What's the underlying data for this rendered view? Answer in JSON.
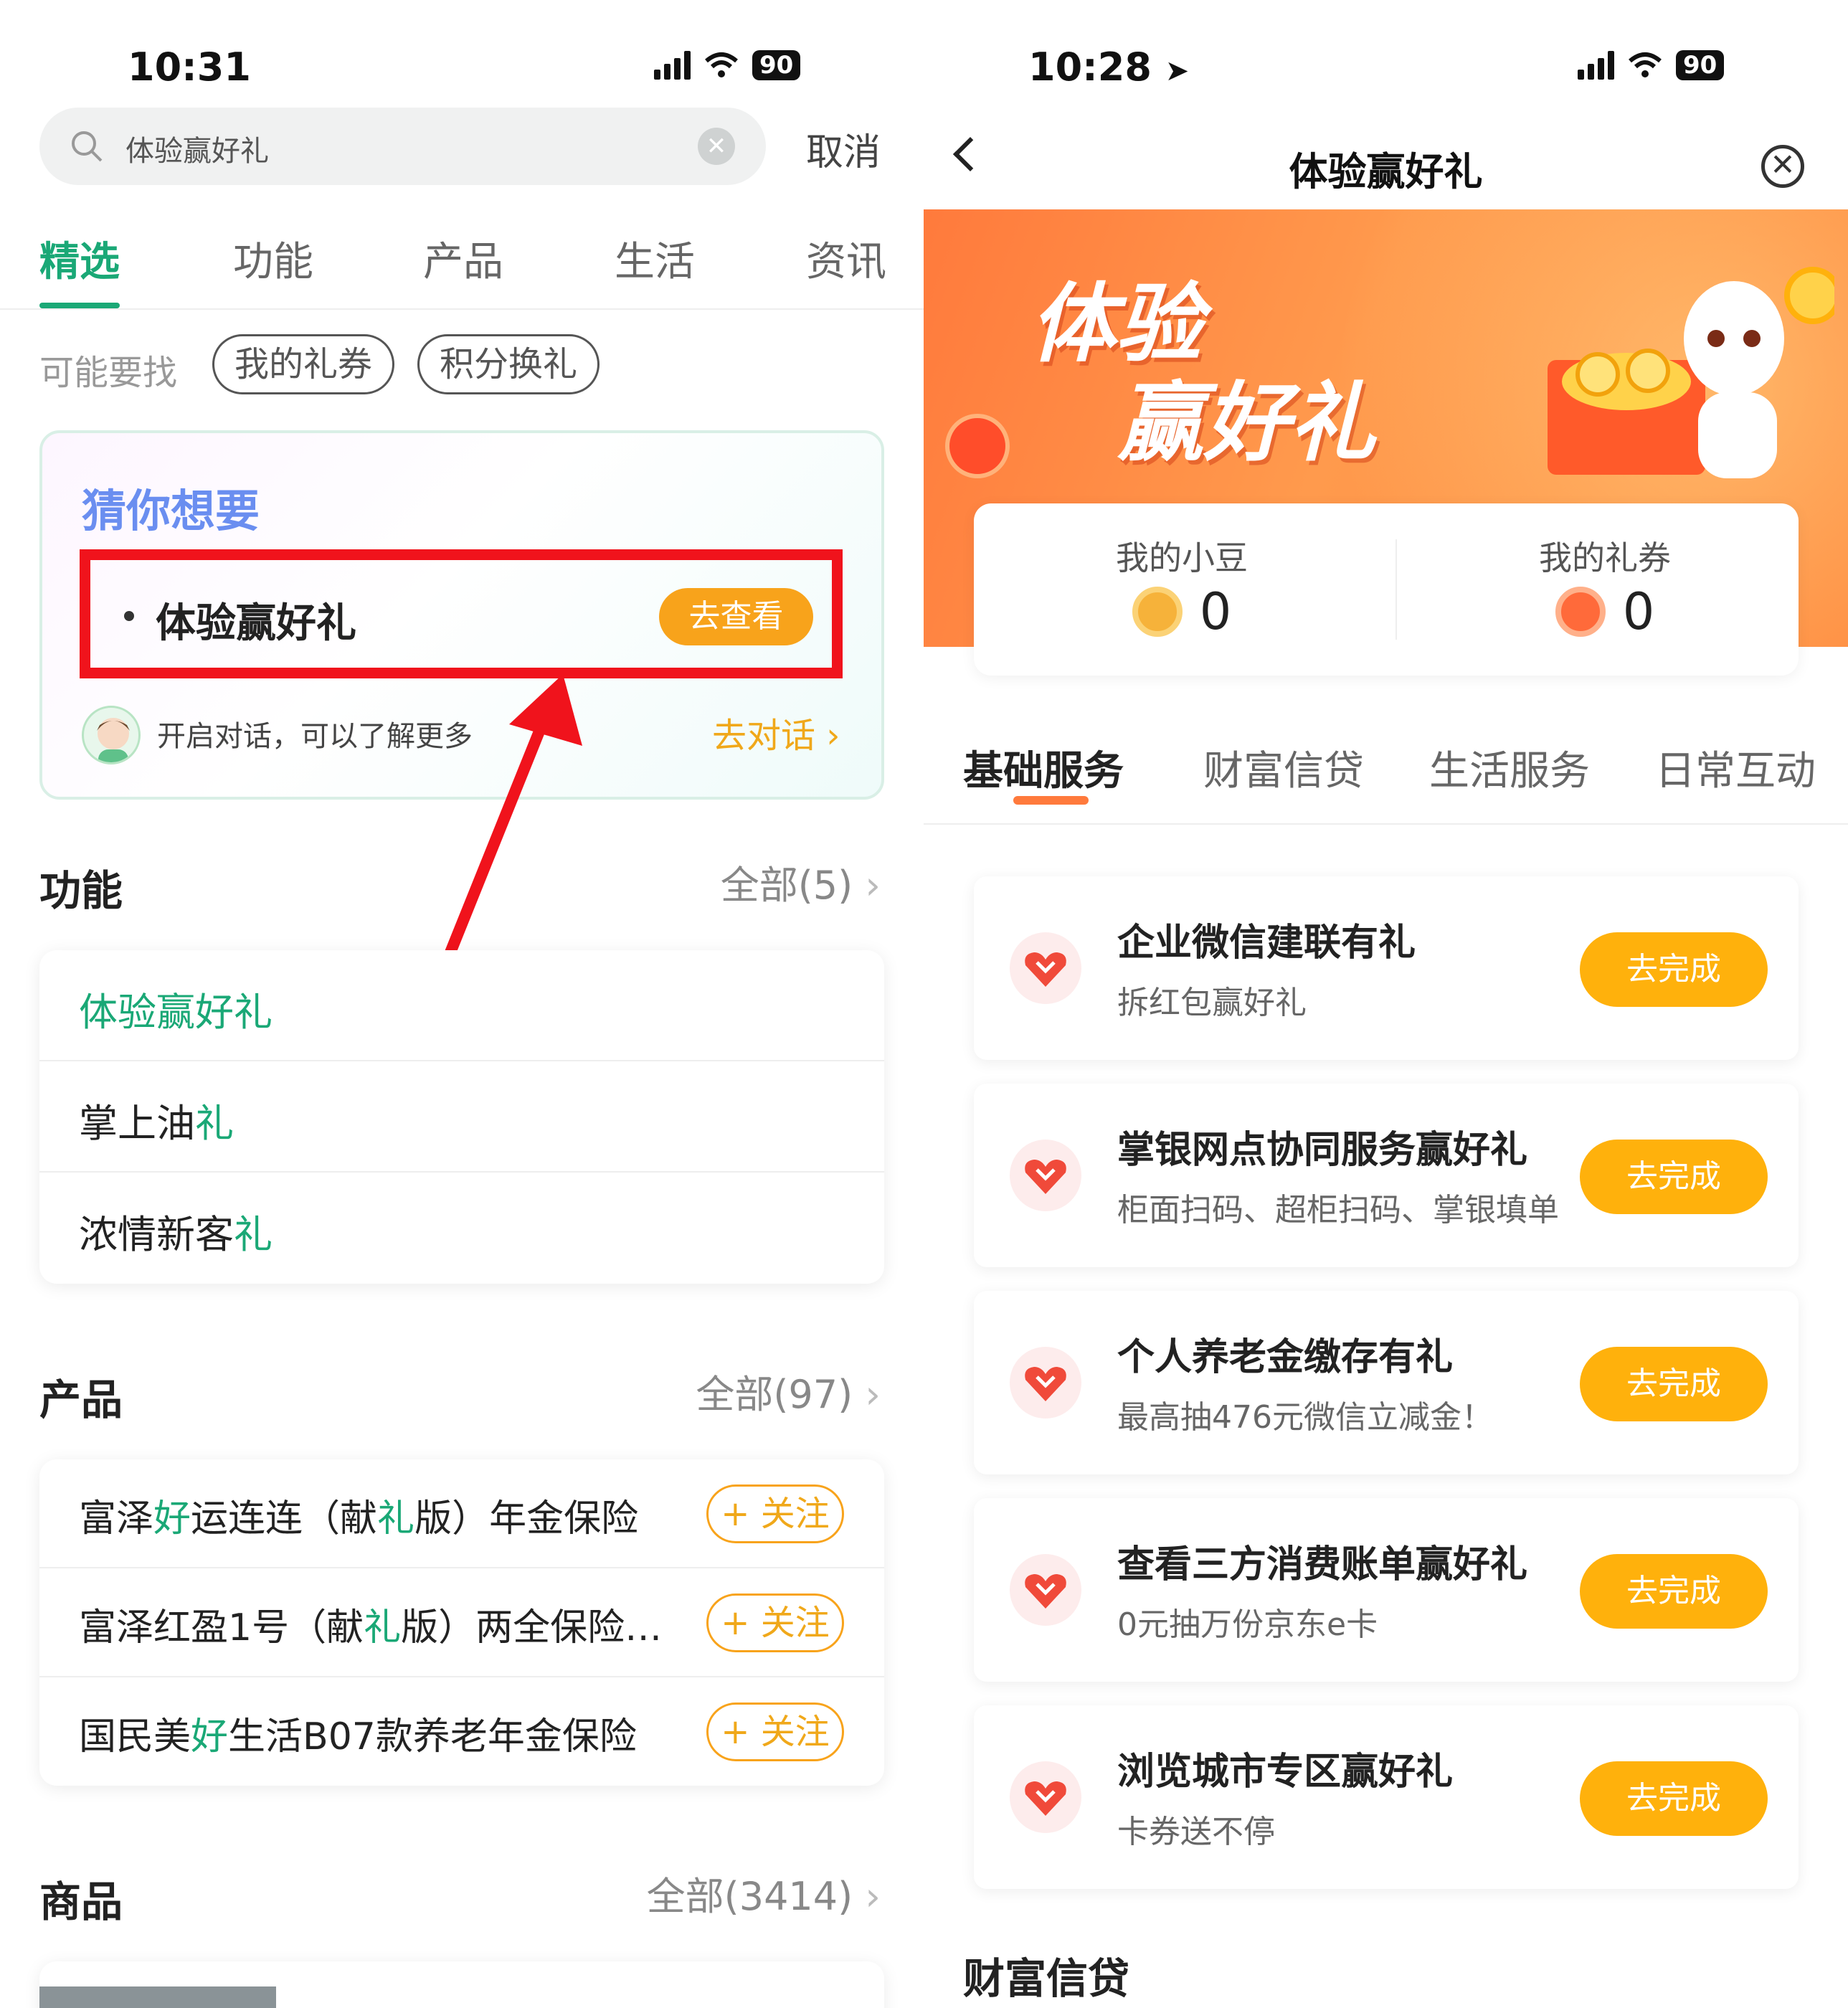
{
  "left": {
    "status": {
      "time": "10:31",
      "battery": "90"
    },
    "search": {
      "query": "体验赢好礼",
      "cancel": "取消"
    },
    "tabs": [
      "精选",
      "功能",
      "产品",
      "生活",
      "资讯"
    ],
    "maybe": {
      "label": "可能要找",
      "chips": [
        "我的礼券",
        "积分换礼"
      ]
    },
    "guess": {
      "title": "猜你想要",
      "item": "体验赢好礼",
      "button": "去查看",
      "chat_text": "开启对话，可以了解更多",
      "chat_link": "去对话 ›"
    },
    "functions": {
      "title": "功能",
      "more": "全部(5)",
      "items": [
        {
          "pre": "",
          "hl": "体验赢好礼",
          "post": ""
        },
        {
          "pre": "掌上油",
          "hl": "礼",
          "post": ""
        },
        {
          "pre": "浓情新客",
          "hl": "礼",
          "post": ""
        }
      ]
    },
    "products": {
      "title": "产品",
      "more": "全部(97)",
      "follow": "+ 关注",
      "items": [
        {
          "a": "富泽",
          "b": "好",
          "c": "运连连（献",
          "d": "礼",
          "e": "版）年金保险"
        },
        {
          "a": "富泽红盈1号（献",
          "b": "礼",
          "c": "版）两全保险…",
          "d": "",
          "e": ""
        },
        {
          "a": "国民美",
          "b": "好",
          "c": "生活B07款养老年金保险",
          "d": "",
          "e": ""
        }
      ]
    },
    "goods": {
      "title": "商品",
      "more": "全部(3414)"
    }
  },
  "right": {
    "status": {
      "time": "10:28",
      "battery": "90"
    },
    "nav": {
      "title": "体验赢好礼"
    },
    "banner": {
      "line1": "体验",
      "line2": "赢好礼"
    },
    "scores": [
      {
        "label": "我的小豆",
        "value": "0"
      },
      {
        "label": "我的礼券",
        "value": "0"
      }
    ],
    "tabs": [
      "基础服务",
      "财富信贷",
      "生活服务",
      "日常互动"
    ],
    "tasks": [
      {
        "title": "企业微信建联有礼",
        "sub": "拆红包赢好礼",
        "button": "去完成"
      },
      {
        "title": "掌银网点协同服务赢好礼",
        "sub": "柜面扫码、超柜扫码、掌银填单",
        "button": "去完成"
      },
      {
        "title": "个人养老金缴存有礼",
        "sub": "最高抽476元微信立减金！",
        "button": "去完成"
      },
      {
        "title": "查看三方消费账单赢好礼",
        "sub": "0元抽万份京东e卡",
        "button": "去完成"
      },
      {
        "title": "浏览城市专区赢好礼",
        "sub": "卡券送不停",
        "button": "去完成"
      }
    ],
    "section2": "财富信贷"
  },
  "colors": {
    "green": "#1aa876",
    "orange": "#f8a31b",
    "red_annotation": "#f0131c",
    "banner": "#ff8a3e"
  }
}
